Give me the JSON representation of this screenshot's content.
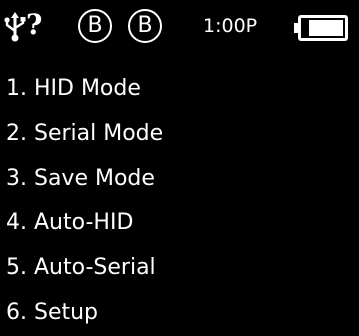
{
  "status_bar": {
    "usb_icon": "usb-icon",
    "usb_status": "?",
    "badges": [
      "B",
      "B"
    ],
    "clock": "1:00P",
    "battery": {
      "icon": "battery-icon",
      "level": 0.85
    }
  },
  "menu": {
    "items": [
      {
        "label": "1. HID Mode"
      },
      {
        "label": "2. Serial Mode"
      },
      {
        "label": "3. Save Mode"
      },
      {
        "label": "4. Auto-HID"
      },
      {
        "label": "5. Auto-Serial"
      },
      {
        "label": "6. Setup"
      }
    ]
  },
  "colors": {
    "background": "#000000",
    "foreground": "#ffffff"
  }
}
